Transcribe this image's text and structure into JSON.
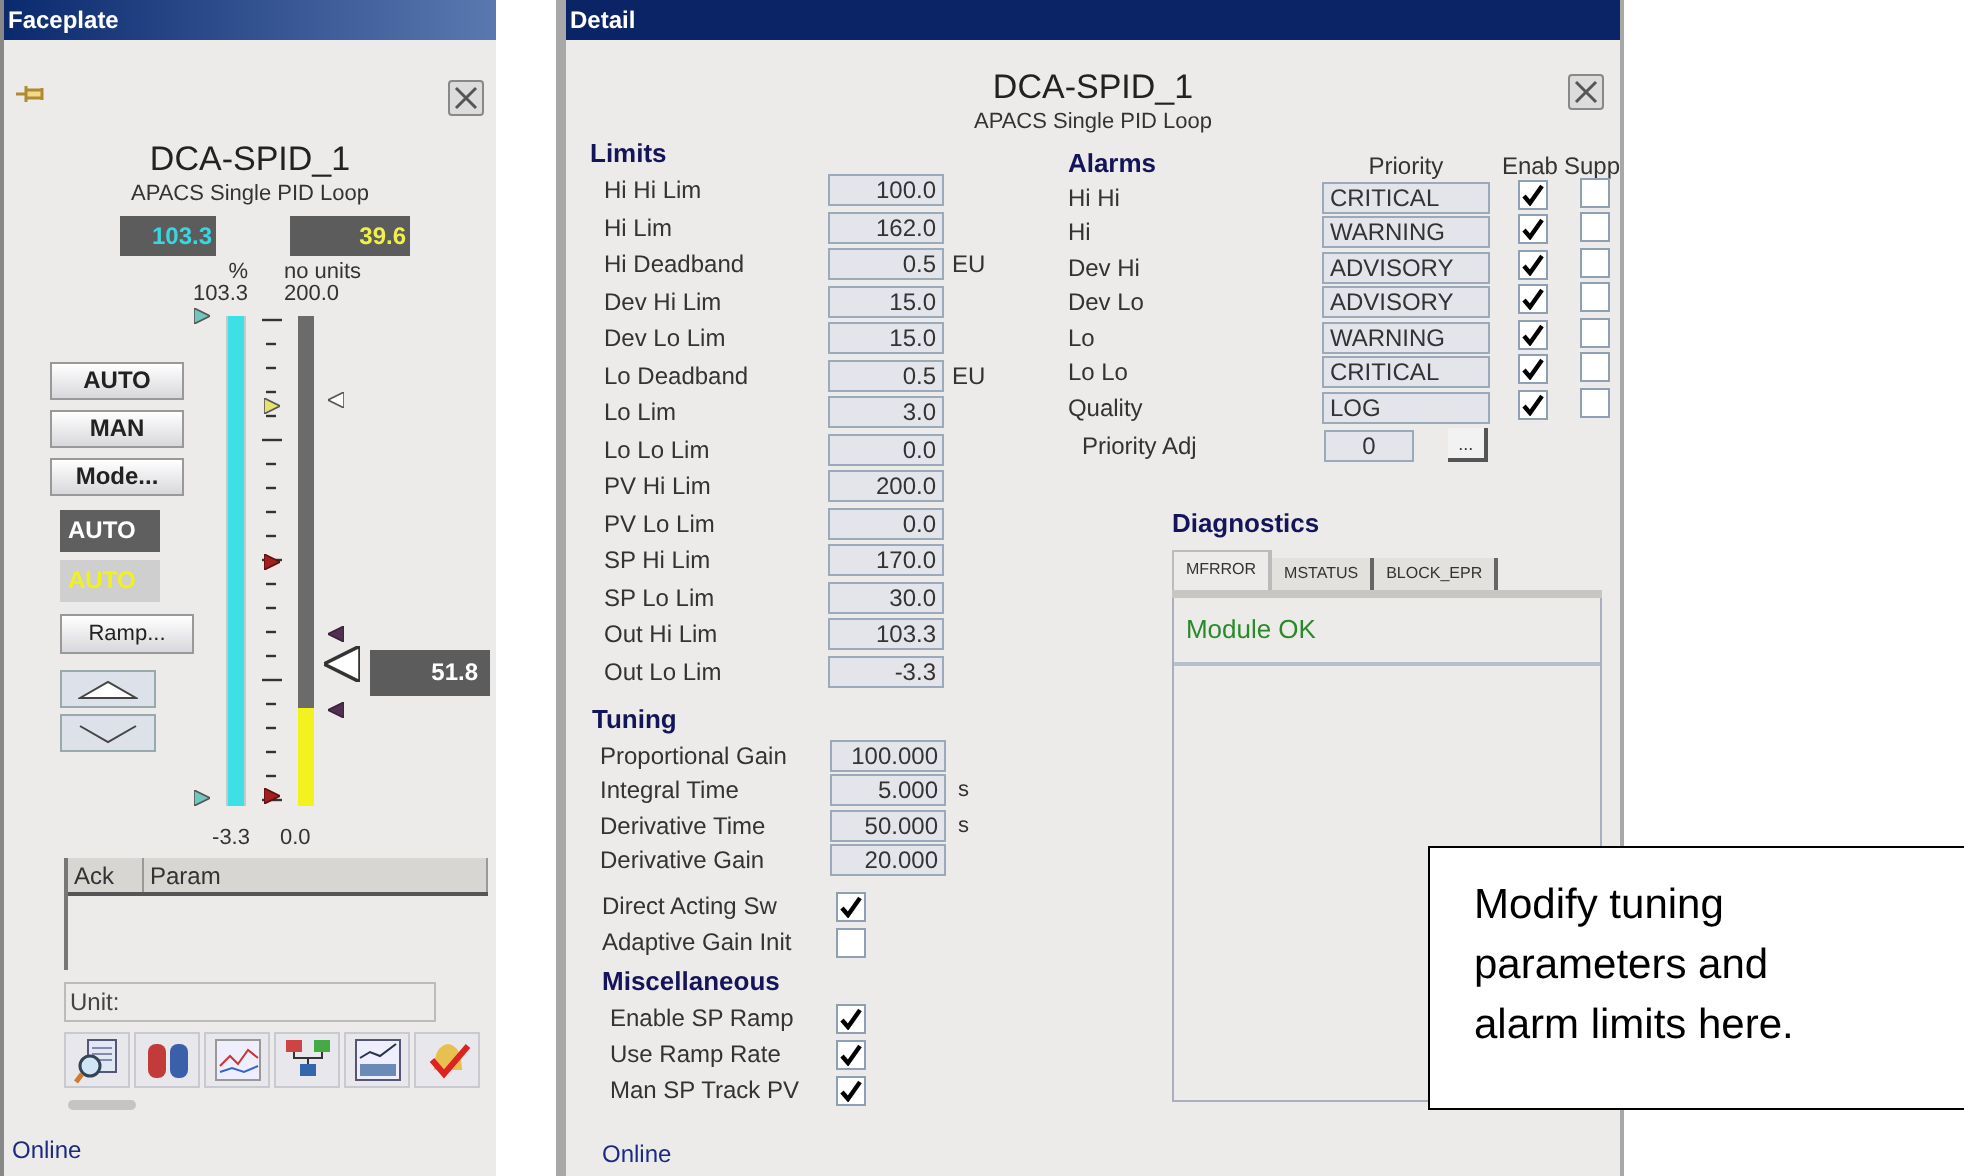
{
  "faceplate": {
    "title": "Faceplate",
    "tag": "DCA-SPID_1",
    "description": "APACS Single PID Loop",
    "left_value": "103.3",
    "right_value": "39.6",
    "left_unit": "%",
    "right_unit": "no units",
    "left_high": "103.3",
    "right_high": "200.0",
    "left_low": "-3.3",
    "right_low": "0.0",
    "left_bar": {
      "level": 1
    },
    "right_bar": {
      "level": 0.2
    },
    "readout": "51.8",
    "mode_buttons": [
      "AUTO",
      "MAN",
      "Mode..."
    ],
    "modes": [
      {
        "label": "AUTO",
        "kind": "actual"
      },
      {
        "label": "AUTO",
        "kind": "target"
      }
    ],
    "ramp_button": "Ramp...",
    "table": {
      "columns": [
        "Ack",
        "Param"
      ]
    },
    "unit_field": "Unit:",
    "status": "Online"
  },
  "detail": {
    "title": "Detail",
    "tag": "DCA-SPID_1",
    "description": "APACS Single PID Loop",
    "limits": {
      "heading": "Limits",
      "rows": [
        {
          "label": "Hi Hi Lim",
          "value": "100.0"
        },
        {
          "label": "Hi Lim",
          "value": "162.0"
        },
        {
          "label": "Hi Deadband",
          "value": "0.5",
          "unit": "EU"
        },
        {
          "label": "Dev Hi Lim",
          "value": "15.0"
        },
        {
          "label": "Dev Lo Lim",
          "value": "15.0"
        },
        {
          "label": "Lo Deadband",
          "value": "0.5",
          "unit": "EU"
        },
        {
          "label": "Lo Lim",
          "value": "3.0"
        },
        {
          "label": "Lo Lo Lim",
          "value": "0.0"
        },
        {
          "label": "PV Hi Lim",
          "value": "200.0"
        },
        {
          "label": "PV Lo Lim",
          "value": "0.0"
        },
        {
          "label": "SP Hi Lim",
          "value": "170.0"
        },
        {
          "label": "SP Lo Lim",
          "value": "30.0"
        },
        {
          "label": "Out Hi Lim",
          "value": "103.3"
        },
        {
          "label": "Out Lo Lim",
          "value": "-3.3"
        }
      ]
    },
    "tuning": {
      "heading": "Tuning",
      "rows": [
        {
          "label": "Proportional Gain",
          "value": "100.000"
        },
        {
          "label": "Integral Time",
          "value": "5.000",
          "unit": "s"
        },
        {
          "label": "Derivative Time",
          "value": "50.000",
          "unit": "s"
        },
        {
          "label": "Derivative Gain",
          "value": "20.000"
        }
      ],
      "switches": [
        {
          "label": "Direct Acting Sw",
          "checked": true
        },
        {
          "label": "Adaptive Gain Init",
          "checked": false
        }
      ]
    },
    "miscellaneous": {
      "heading": "Miscellaneous",
      "items": [
        {
          "label": "Enable SP Ramp",
          "checked": true
        },
        {
          "label": "Use Ramp Rate",
          "checked": true
        },
        {
          "label": "Man SP Track PV",
          "checked": true
        }
      ]
    },
    "alarms": {
      "heading": "Alarms",
      "columns": [
        "Priority",
        "Enab",
        "Supp"
      ],
      "rows": [
        {
          "label": "Hi Hi",
          "priority": "CRITICAL",
          "enabled": true,
          "suppressed": false
        },
        {
          "label": "Hi",
          "priority": "WARNING",
          "enabled": true,
          "suppressed": false
        },
        {
          "label": "Dev Hi",
          "priority": "ADVISORY",
          "enabled": true,
          "suppressed": false
        },
        {
          "label": "Dev Lo",
          "priority": "ADVISORY",
          "enabled": true,
          "suppressed": false
        },
        {
          "label": "Lo",
          "priority": "WARNING",
          "enabled": true,
          "suppressed": false
        },
        {
          "label": "Lo Lo",
          "priority": "CRITICAL",
          "enabled": true,
          "suppressed": false
        },
        {
          "label": "Quality",
          "priority": "LOG",
          "enabled": true,
          "suppressed": false
        }
      ],
      "priority_adj": {
        "label": "Priority Adj",
        "value": "0",
        "button": "..."
      }
    },
    "diagnostics": {
      "heading": "Diagnostics",
      "tabs": [
        {
          "label": "MFRROR",
          "selected": true
        },
        {
          "label": "MSTATUS",
          "selected": false
        },
        {
          "label": "BLOCK_EPR",
          "selected": false
        }
      ],
      "message": "Module OK"
    },
    "status": "Online"
  },
  "callout": {
    "text": "Modify tuning parameters and alarm limits here."
  }
}
